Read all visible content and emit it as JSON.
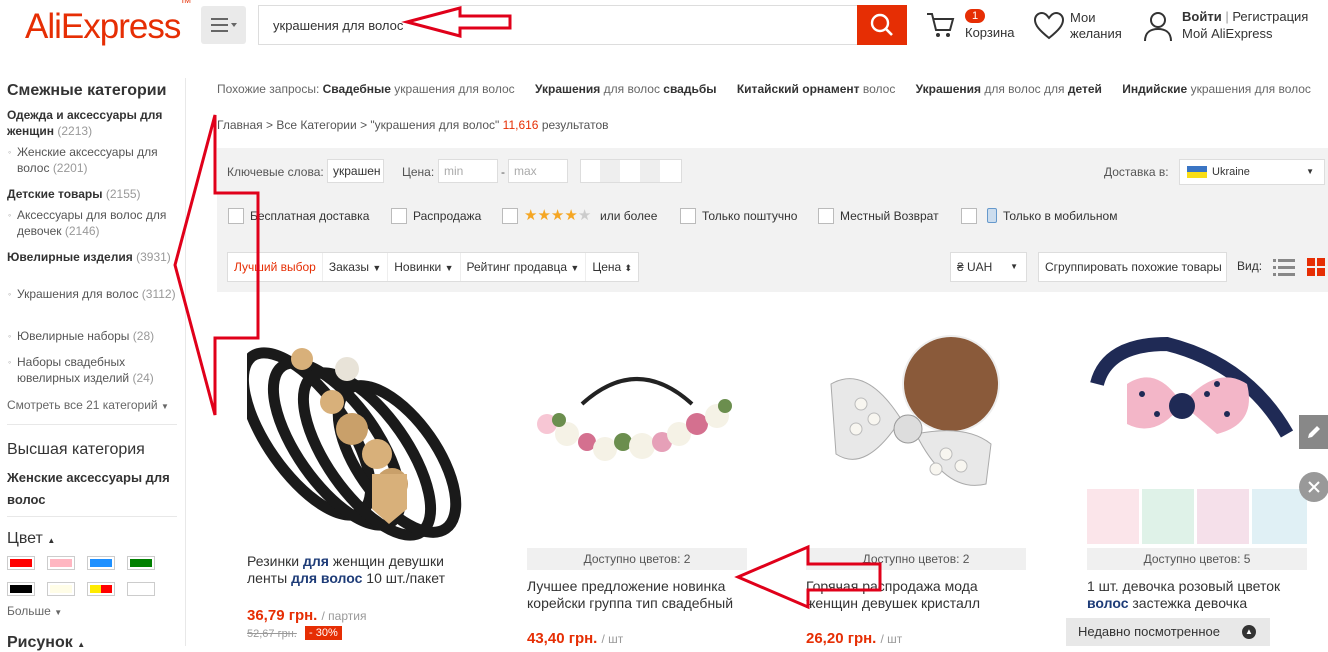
{
  "header": {
    "logo": "AliExpress",
    "logo_tm": "TM",
    "search_value": "украшения для волос",
    "cart_count": "1",
    "cart_label": "Корзина",
    "wish_label_1": "Мои",
    "wish_label_2": "желания",
    "login": "Войти",
    "separator": "|",
    "register": "Регистрация",
    "my_account": "Мой AliExpress"
  },
  "sidebar": {
    "title": "Смежные категории",
    "cat1": {
      "name": "Одежда и аксессуары для женщин",
      "count": "(2213)"
    },
    "cat1_sub1": {
      "name": "Женские аксессуары для волос",
      "count": "(2201)"
    },
    "cat2": {
      "name": "Детские товары",
      "count": "(2155)"
    },
    "cat2_sub1": {
      "name": "Аксессуары для волос для девочек",
      "count": "(2146)"
    },
    "cat3": {
      "name": "Ювелирные изделия",
      "count": "(3931)"
    },
    "cat3_sub1": {
      "name": "Украшения для волос",
      "count": "(3112)"
    },
    "cat3_sub2": {
      "name": "Ювелирные наборы",
      "count": "(28)"
    },
    "cat3_sub3": {
      "name": "Наборы свадебных ювелирных изделий",
      "count": "(24)"
    },
    "see_all": "Смотреть все 21 категорий",
    "top_category_heading": "Высшая категория",
    "top_category": "Женские аксессуары для волос",
    "color_heading": "Цвет",
    "more": "Больше",
    "pattern_heading": "Рисунок"
  },
  "related": {
    "label": "Похожие запросы:",
    "items": [
      {
        "bold": "Свадебные",
        "rest": "украшения для волос"
      },
      {
        "bold": "Украшения",
        "rest": "для волос",
        "bold2": "свадьбы"
      },
      {
        "bold": "Китайский орнамент",
        "rest": "волос"
      },
      {
        "bold": "Украшения",
        "rest": "для волос для",
        "bold2": "детей"
      },
      {
        "bold": "Индийские",
        "rest": "украшения для волос"
      }
    ]
  },
  "breadcrumb": {
    "home": "Главная",
    "all": "Все Категории",
    "query": "\"украшения для волос\"",
    "count": "11,616",
    "results": "результатов",
    "sep": ">"
  },
  "filters": {
    "keywords_label": "Ключевые слова:",
    "keywords_value": "украшен",
    "price_label": "Цена:",
    "min_placeholder": "min",
    "max_placeholder": "max",
    "dash": "-",
    "ship_to_label": "Доставка в:",
    "ship_to_value": "Ukraine",
    "free_shipping": "Бесплатная доставка",
    "sale": "Распродажа",
    "or_more": "или более",
    "wholesale": "Только поштучно",
    "local_return": "Местный Возврат",
    "mobile_only": "Только в мобильном",
    "stars_rating": 4
  },
  "sortbar": {
    "best": "Лучший выбор",
    "orders": "Заказы",
    "new": "Новинки",
    "seller_rating": "Рейтинг продавца",
    "price": "Цена",
    "currency": "₴ UAH",
    "group_similar": "Сгруппировать похожие товары",
    "view_label": "Вид:"
  },
  "products": [
    {
      "title_pre": "Резинки ",
      "title_b1": "для",
      "title_mid": " женщин девушки ленты ",
      "title_b2": "для волос",
      "title_post": " 10 шт./пакет",
      "price": "36,79 грн.",
      "unit": "/ партия",
      "old_price": "52,67 грн.",
      "discount": "- 30%"
    },
    {
      "colors": "Доступно цветов: 2",
      "title": "Лучшее предложение новинка корейски группа тип свадебный",
      "price": "43,40 грн.",
      "unit": "/ шт"
    },
    {
      "colors": "Доступно цветов: 2",
      "title": "Горячая распродажа мода женщин девушек кристалл",
      "price": "26,20 грн.",
      "unit": "/ шт"
    },
    {
      "colors": "Доступно цветов: 5",
      "title_pre": "1 шт. девочка розовый цветок ",
      "title_b1": "волос",
      "title_post": " застежка девочка"
    }
  ],
  "recently_viewed": "Недавно посмотренное",
  "colors": {
    "accent": "#e62e04",
    "swatches": [
      "#ff0000",
      "#ffb6c1",
      "#1e90ff",
      "#008000",
      "#000000",
      "#fffde7",
      "#ffeb00",
      "#ffffff"
    ],
    "arrow": "#e0001a"
  }
}
